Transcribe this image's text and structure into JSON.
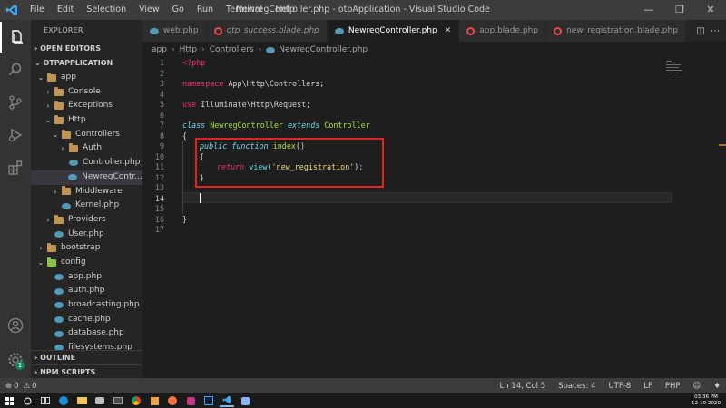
{
  "window": {
    "title": "NewregController.php - otpApplication - Visual Studio Code",
    "menu": [
      "File",
      "Edit",
      "Selection",
      "View",
      "Go",
      "Run",
      "Terminal",
      "Help"
    ]
  },
  "sidebar": {
    "header": "EXPLORER",
    "open_editors": "OPEN EDITORS",
    "project": "OTPAPPLICATION",
    "tree": [
      {
        "label": "app",
        "depth": 1,
        "kind": "folder",
        "expanded": true
      },
      {
        "label": "Console",
        "depth": 2,
        "kind": "folder",
        "expanded": false
      },
      {
        "label": "Exceptions",
        "depth": 2,
        "kind": "folder",
        "expanded": false
      },
      {
        "label": "Http",
        "depth": 2,
        "kind": "folder",
        "expanded": true
      },
      {
        "label": "Controllers",
        "depth": 3,
        "kind": "folder",
        "expanded": true
      },
      {
        "label": "Auth",
        "depth": 4,
        "kind": "folder",
        "expanded": false
      },
      {
        "label": "Controller.php",
        "depth": 4,
        "kind": "php"
      },
      {
        "label": "NewregContr...",
        "depth": 4,
        "kind": "php",
        "selected": true
      },
      {
        "label": "Middleware",
        "depth": 3,
        "kind": "folder",
        "expanded": false
      },
      {
        "label": "Kernel.php",
        "depth": 3,
        "kind": "php"
      },
      {
        "label": "Providers",
        "depth": 2,
        "kind": "folder",
        "expanded": false
      },
      {
        "label": "User.php",
        "depth": 2,
        "kind": "php"
      },
      {
        "label": "bootstrap",
        "depth": 1,
        "kind": "folder",
        "expanded": false
      },
      {
        "label": "config",
        "depth": 1,
        "kind": "folder-green",
        "expanded": true
      },
      {
        "label": "app.php",
        "depth": 2,
        "kind": "php"
      },
      {
        "label": "auth.php",
        "depth": 2,
        "kind": "php"
      },
      {
        "label": "broadcasting.php",
        "depth": 2,
        "kind": "php"
      },
      {
        "label": "cache.php",
        "depth": 2,
        "kind": "php"
      },
      {
        "label": "database.php",
        "depth": 2,
        "kind": "php"
      },
      {
        "label": "filesystems.php",
        "depth": 2,
        "kind": "php"
      }
    ],
    "outline": "OUTLINE",
    "npm_scripts": "NPM SCRIPTS"
  },
  "tabs": [
    {
      "label": "web.php",
      "icon": "php",
      "active": false,
      "italic": false
    },
    {
      "label": "otp_success.blade.php",
      "icon": "blade",
      "active": false,
      "italic": true
    },
    {
      "label": "NewregController.php",
      "icon": "php",
      "active": true,
      "italic": false
    },
    {
      "label": "app.blade.php",
      "icon": "blade",
      "active": false,
      "italic": false
    },
    {
      "label": "new_registration.blade.php",
      "icon": "blade",
      "active": false,
      "italic": false
    }
  ],
  "breadcrumb": [
    "app",
    "Http",
    "Controllers",
    "NewregController.php"
  ],
  "editor": {
    "line_numbers": [
      "1",
      "2",
      "3",
      "4",
      "5",
      "6",
      "7",
      "8",
      "9",
      "10",
      "11",
      "12",
      "13",
      "14",
      "15",
      "16",
      "17"
    ],
    "code": {
      "l1": "<?php",
      "l3_kw": "namespace",
      "l3_ns": "App\\Http\\Controllers;",
      "l5_kw": "use",
      "l5_ns": "Illuminate\\Http\\Request;",
      "l7_kw": "class",
      "l7_name": "NewregController",
      "l7_ext": "extends",
      "l7_parent": "Controller",
      "brace_open": "{",
      "l9_pub": "public",
      "l9_fn": "function",
      "l9_name": "index",
      "l9_paren": "()",
      "l11_ret": "return",
      "l11_view": "view",
      "l11_str": "'new_registration'",
      "l11_end": ");",
      "brace_close": "}"
    }
  },
  "status": {
    "errors": "0",
    "warnings": "0",
    "position": "Ln 14, Col 5",
    "spaces": "Spaces: 4",
    "encoding": "UTF-8",
    "eol": "LF",
    "language": "PHP"
  },
  "clock": {
    "time": "03:36 PM",
    "date": "12-10-2020"
  },
  "activity_badge": "1",
  "colors": {
    "accent": "#007acc",
    "highlight_box": "#e02424",
    "folder": "#c09553",
    "php_icon": "#519aba",
    "blade_icon": "#e44c4c"
  }
}
